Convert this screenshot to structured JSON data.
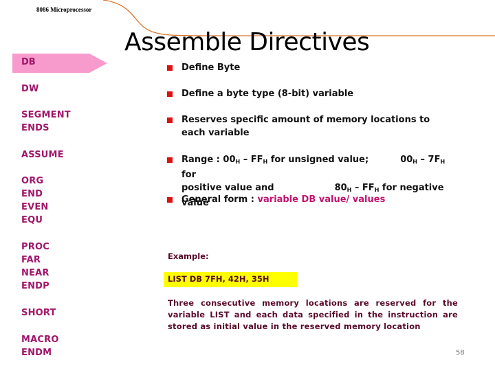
{
  "header": {
    "label": "8086 Microprocessor"
  },
  "slide": {
    "title": "Assemble Directives",
    "page_number": "58"
  },
  "sidebar": {
    "active_item": "DB",
    "items": [
      {
        "lines": [
          "DW"
        ]
      },
      {
        "lines": [
          "SEGMENT",
          "ENDS"
        ]
      },
      {
        "lines": [
          "ASSUME"
        ]
      },
      {
        "lines": [
          "ORG",
          "END",
          "EVEN",
          "EQU"
        ]
      },
      {
        "lines": [
          "PROC",
          "FAR",
          "NEAR",
          "ENDP"
        ]
      },
      {
        "lines": [
          "SHORT"
        ]
      },
      {
        "lines": [
          "MACRO",
          "ENDM"
        ]
      }
    ]
  },
  "bullets": {
    "b1": "Define Byte",
    "b2": "Define a byte type (8-bit) variable",
    "b3": "Reserves specific amount of memory locations to each variable",
    "b4": {
      "range_label": "Range : ",
      "v1": "00",
      "s1": "H",
      "dash1": " – ",
      "v2": "FF",
      "s2": "H",
      "t1": " for unsigned value;",
      "v3": "00",
      "s3": "H",
      "dash2": " – ",
      "v4": "7F",
      "s4": "H",
      "t2": " for positive value and",
      "v5": "80",
      "s5": "H",
      "dash3": " – ",
      "v6": "FF",
      "s6": "H",
      "t3": " for negative value"
    },
    "b5": {
      "label": "General form : ",
      "value": "variable DB value/ values"
    }
  },
  "example": {
    "label": "Example:",
    "code": "LIST DB 7FH, 42H, 35H",
    "description": "Three consecutive memory locations are reserved for the variable LIST and each data specified in the instruction are stored as initial value in the reserved memory location"
  },
  "colors": {
    "accent_pink": "#a0176b",
    "arrow_fill": "#f79bcc",
    "bullet_red": "#e01010",
    "highlight_yellow": "#ffff00",
    "curve_orange": "#d9752a"
  }
}
